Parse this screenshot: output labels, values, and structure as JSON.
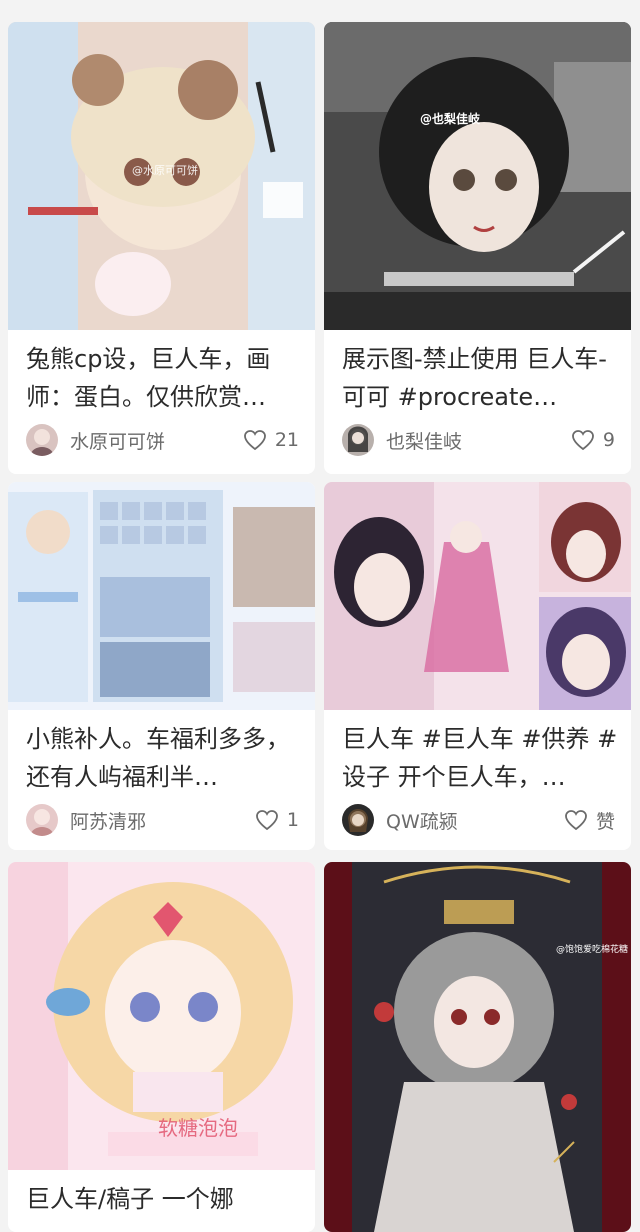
{
  "posts": [
    {
      "title": "兔熊cp设，巨人车，画师：蛋白。仅供欣赏…",
      "author": "水原可可饼",
      "likes": "21",
      "watermark": "@水原可可饼",
      "thumb_colors": [
        "#e9d9cf",
        "#cfe0ef",
        "#f3e8dc"
      ]
    },
    {
      "title": "展示图-禁止使用 巨人车-可可 #procreate…",
      "author": "也梨佳岐",
      "likes": "9",
      "watermark": "@也梨佳岐",
      "thumb_colors": [
        "#3a3a3a",
        "#6d6d6d",
        "#c7c2bd"
      ]
    },
    {
      "title": "小熊补人。车福利多多，还有人屿福利半…",
      "author": "阿苏清邪",
      "likes": "1",
      "watermark": "",
      "thumb_colors": [
        "#d7e6f5",
        "#eef3fb",
        "#bfd4ea"
      ]
    },
    {
      "title": "巨人车 #巨人车 #供养 #设子 开个巨人车，…",
      "author": "QW疏颍",
      "likes": "赞",
      "watermark": "",
      "thumb_colors": [
        "#f2d7e2",
        "#e9c5d6",
        "#b9a8d8"
      ]
    },
    {
      "title": "巨人车/稿子 一个娜",
      "author": "",
      "likes": "",
      "watermark": "软糖泡泡",
      "thumb_colors": [
        "#f7d8e2",
        "#fbe8ee",
        "#f0b9c8"
      ]
    },
    {
      "title": "",
      "author": "",
      "likes": "",
      "watermark": "@饱饱爱吃棉花糖",
      "thumb_colors": [
        "#6e1420",
        "#3a0e14",
        "#b8b2ad"
      ]
    }
  ]
}
